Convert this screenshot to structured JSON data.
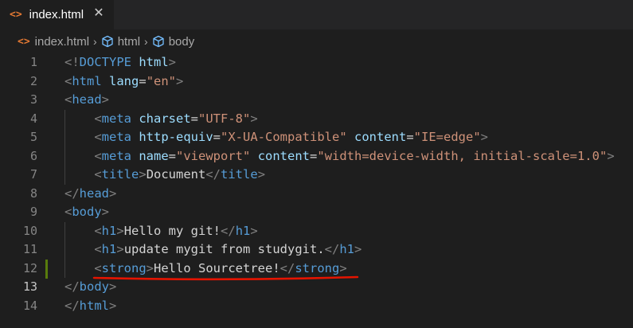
{
  "tab": {
    "label": "index.html",
    "icon": "html-file-icon",
    "close": "✕"
  },
  "breadcrumb": {
    "file": "index.html",
    "items": [
      "html",
      "body"
    ],
    "separator": "›"
  },
  "colors": {
    "tag": "#569cd6",
    "attribute": "#9cdcfe",
    "string": "#ce9178",
    "bracket": "#808080",
    "annotation_underline": "#e51400",
    "modified_gutter": "#587c0c"
  },
  "lines": [
    {
      "n": "1",
      "parts": [
        [
          "t",
          "<!"
        ],
        [
          "tag",
          "DOCTYPE"
        ],
        [
          "txt",
          " "
        ],
        [
          "attr",
          "html"
        ],
        [
          "t",
          ">"
        ]
      ]
    },
    {
      "n": "2",
      "parts": [
        [
          "t",
          "<"
        ],
        [
          "tag",
          "html"
        ],
        [
          "txt",
          " "
        ],
        [
          "attr",
          "lang"
        ],
        [
          "txt",
          "="
        ],
        [
          "str",
          "\"en\""
        ],
        [
          "t",
          ">"
        ]
      ]
    },
    {
      "n": "3",
      "parts": [
        [
          "t",
          "<"
        ],
        [
          "tag",
          "head"
        ],
        [
          "t",
          ">"
        ]
      ]
    },
    {
      "n": "4",
      "indent": "    ",
      "parts": [
        [
          "t",
          "<"
        ],
        [
          "tag",
          "meta"
        ],
        [
          "txt",
          " "
        ],
        [
          "attr",
          "charset"
        ],
        [
          "txt",
          "="
        ],
        [
          "str",
          "\"UTF-8\""
        ],
        [
          "t",
          ">"
        ]
      ]
    },
    {
      "n": "5",
      "indent": "    ",
      "parts": [
        [
          "t",
          "<"
        ],
        [
          "tag",
          "meta"
        ],
        [
          "txt",
          " "
        ],
        [
          "attr",
          "http-equiv"
        ],
        [
          "txt",
          "="
        ],
        [
          "str",
          "\"X-UA-Compatible\""
        ],
        [
          "txt",
          " "
        ],
        [
          "attr",
          "content"
        ],
        [
          "txt",
          "="
        ],
        [
          "str",
          "\"IE=edge\""
        ],
        [
          "t",
          ">"
        ]
      ]
    },
    {
      "n": "6",
      "indent": "    ",
      "parts": [
        [
          "t",
          "<"
        ],
        [
          "tag",
          "meta"
        ],
        [
          "txt",
          " "
        ],
        [
          "attr",
          "name"
        ],
        [
          "txt",
          "="
        ],
        [
          "str",
          "\"viewport\""
        ],
        [
          "txt",
          " "
        ],
        [
          "attr",
          "content"
        ],
        [
          "txt",
          "="
        ],
        [
          "str",
          "\"width=device-width, initial-scale=1.0\""
        ],
        [
          "t",
          ">"
        ]
      ]
    },
    {
      "n": "7",
      "indent": "    ",
      "parts": [
        [
          "t",
          "<"
        ],
        [
          "tag",
          "title"
        ],
        [
          "t",
          ">"
        ],
        [
          "txt",
          "Document"
        ],
        [
          "t",
          "</"
        ],
        [
          "tag",
          "title"
        ],
        [
          "t",
          ">"
        ]
      ]
    },
    {
      "n": "8",
      "parts": [
        [
          "t",
          "</"
        ],
        [
          "tag",
          "head"
        ],
        [
          "t",
          ">"
        ]
      ]
    },
    {
      "n": "9",
      "parts": [
        [
          "t",
          "<"
        ],
        [
          "tag",
          "body"
        ],
        [
          "t",
          ">"
        ]
      ]
    },
    {
      "n": "10",
      "indent": "    ",
      "parts": [
        [
          "t",
          "<"
        ],
        [
          "tag",
          "h1"
        ],
        [
          "t",
          ">"
        ],
        [
          "txt",
          "Hello my git!"
        ],
        [
          "t",
          "</"
        ],
        [
          "tag",
          "h1"
        ],
        [
          "t",
          ">"
        ]
      ]
    },
    {
      "n": "11",
      "indent": "    ",
      "parts": [
        [
          "t",
          "<"
        ],
        [
          "tag",
          "h1"
        ],
        [
          "t",
          ">"
        ],
        [
          "txt",
          "update mygit from studygit."
        ],
        [
          "t",
          "</"
        ],
        [
          "tag",
          "h1"
        ],
        [
          "t",
          ">"
        ]
      ]
    },
    {
      "n": "12",
      "indent": "    ",
      "parts": [
        [
          "t",
          "<"
        ],
        [
          "tag",
          "strong"
        ],
        [
          "t",
          ">"
        ],
        [
          "txt",
          "Hello Sourcetree!"
        ],
        [
          "t",
          "</"
        ],
        [
          "tag",
          "strong"
        ],
        [
          "t",
          ">"
        ]
      ]
    },
    {
      "n": "13",
      "parts": [
        [
          "t",
          "</"
        ],
        [
          "tag",
          "body"
        ],
        [
          "t",
          ">"
        ]
      ]
    },
    {
      "n": "14",
      "parts": [
        [
          "t",
          "</"
        ],
        [
          "tag",
          "html"
        ],
        [
          "t",
          ">"
        ]
      ]
    }
  ],
  "current_line": "13",
  "modified_line": "12"
}
